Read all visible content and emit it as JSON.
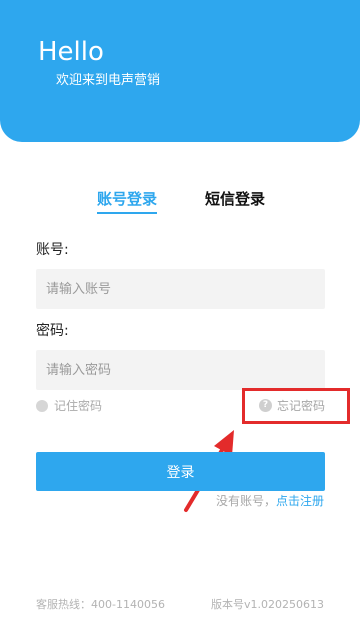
{
  "header": {
    "title": "Hello",
    "subtitle": "欢迎来到电声营销",
    "background_color": "#2ea7ee"
  },
  "tabs": [
    {
      "label": "账号登录",
      "active": true
    },
    {
      "label": "短信登录",
      "active": false
    }
  ],
  "form": {
    "account_label": "账号:",
    "account_placeholder": "请输入账号",
    "account_value": "",
    "password_label": "密码:",
    "password_placeholder": "请输入密码",
    "password_value": "",
    "remember_label": "记住密码",
    "remember_checked": false,
    "forgot_label": "忘记密码",
    "forgot_icon": "question-circle-icon"
  },
  "login_button": {
    "label": "登录",
    "color": "#2ea7ee"
  },
  "register": {
    "prompt": "没有账号，",
    "link": "点击注册"
  },
  "footer": {
    "hotline": "客服热线：400-1140056",
    "version": "版本号v1.020250613"
  },
  "annotation": {
    "highlight_color": "#e32b2b"
  }
}
